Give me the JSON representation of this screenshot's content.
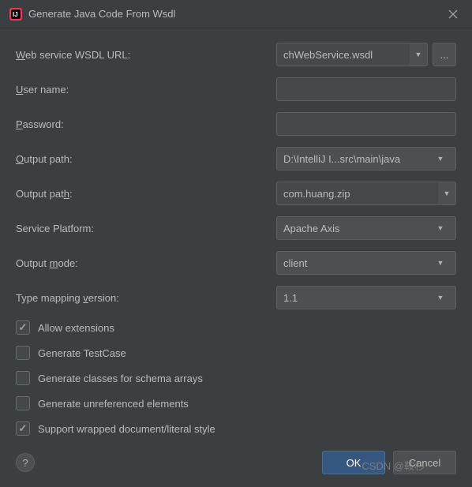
{
  "titlebar": {
    "title": "Generate Java Code From Wsdl"
  },
  "form": {
    "wsdl_url": {
      "label_pre": "",
      "label_mnemonic": "W",
      "label_rest": "eb service WSDL URL:",
      "value": "chWebService.wsdl",
      "browse": "..."
    },
    "user_name": {
      "label_pre": "",
      "label_mnemonic": "U",
      "label_rest": "ser name:",
      "value": ""
    },
    "password": {
      "label_pre": "",
      "label_mnemonic": "P",
      "label_rest": "assword:",
      "value": ""
    },
    "output_path": {
      "label_pre": "",
      "label_mnemonic": "O",
      "label_rest": "utput path:",
      "value": "D:\\IntelliJ I...src\\main\\java"
    },
    "package_path": {
      "label_pre": "Output pat",
      "label_mnemonic": "h",
      "label_rest": ":",
      "value": "com.huang.zip"
    },
    "service_platform": {
      "label": "Service Platform:",
      "value": "Apache Axis"
    },
    "output_mode": {
      "label_pre": "Output ",
      "label_mnemonic": "m",
      "label_rest": "ode:",
      "value": "client"
    },
    "type_mapping": {
      "label_pre": "Type mapping ",
      "label_mnemonic": "v",
      "label_rest": "ersion:",
      "value": "1.1"
    }
  },
  "checkboxes": {
    "allow_extensions": {
      "label_pre": "",
      "label_mnemonic": "A",
      "label_rest": "llow extensions",
      "checked": true
    },
    "generate_testcase": {
      "label_pre": "",
      "label_mnemonic": "G",
      "label_rest": "enerate TestCase",
      "checked": false
    },
    "schema_arrays": {
      "label_pre": "Ge",
      "label_mnemonic": "n",
      "label_rest": "erate classes for schema arrays",
      "checked": false
    },
    "unreferenced": {
      "label_pre": "Gene",
      "label_mnemonic": "r",
      "label_rest": "ate unreferenced elements",
      "checked": false
    },
    "wrapped_doc": {
      "label_pre": "Support wrapped ",
      "label_mnemonic": "d",
      "label_rest": "ocument/literal style",
      "checked": true
    }
  },
  "footer": {
    "help": "?",
    "ok": "OK",
    "cancel": "Cancel"
  },
  "watermark": "CSDN @鞍杉"
}
